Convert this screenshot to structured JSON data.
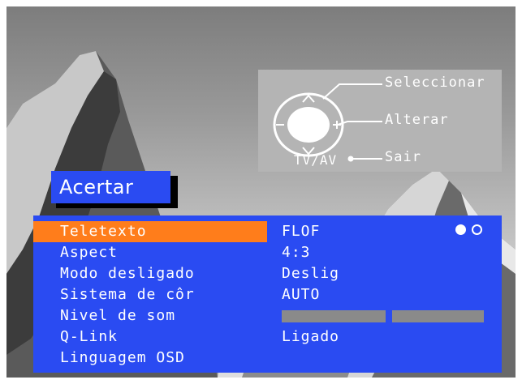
{
  "guide": {
    "select_label": "Seleccionar",
    "change_label": "Alterar",
    "exit_label": "Sair",
    "tvav_label": "TV/AV"
  },
  "menu": {
    "title": "Acertar",
    "items": [
      {
        "label": "Teletexto",
        "value": "FLOF"
      },
      {
        "label": "Aspect",
        "value": "4:3"
      },
      {
        "label": "Modo desligado",
        "value": "Deslig"
      },
      {
        "label": "Sistema de côr",
        "value": "AUTO"
      },
      {
        "label": "Nivel de som",
        "value": ""
      },
      {
        "label": "Q-Link",
        "value": "Ligado"
      },
      {
        "label": "Linguagem OSD",
        "value": ""
      }
    ],
    "selected_index": 0,
    "teletext_page_indicator": {
      "pages": 2,
      "current": 1
    },
    "volume_level_fraction": 0.5
  },
  "colors": {
    "menu_blue": "#2a4bf2",
    "highlight_orange": "#ff7d1b",
    "guide_grey": "#b4b4b4"
  }
}
